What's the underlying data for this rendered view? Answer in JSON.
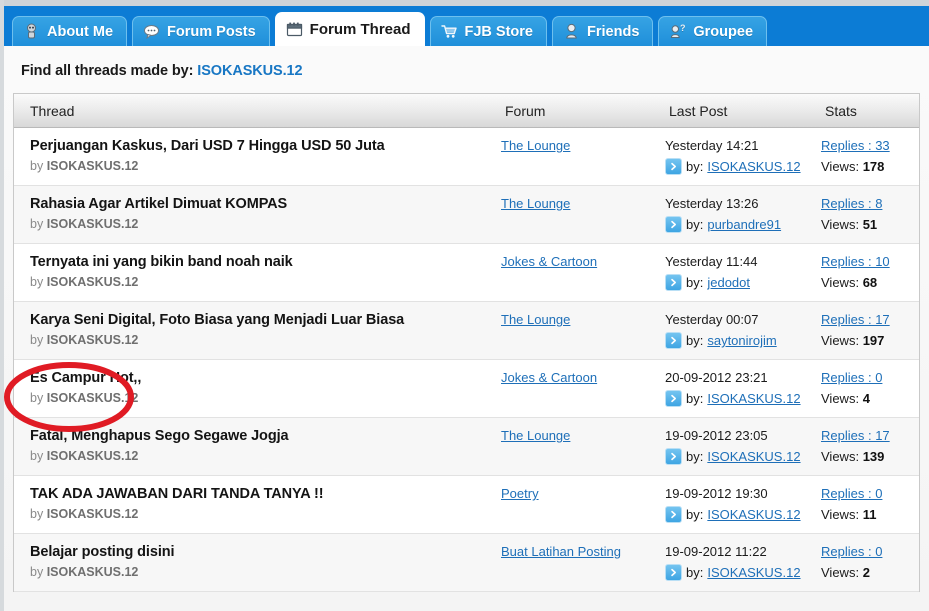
{
  "tabs": [
    {
      "label": "About Me",
      "icon": "user-avatar-icon",
      "active": false
    },
    {
      "label": "Forum Posts",
      "icon": "speech-bubble-icon",
      "active": false
    },
    {
      "label": "Forum Thread",
      "icon": "calendar-icon",
      "active": true
    },
    {
      "label": "FJB Store",
      "icon": "shopping-cart-icon",
      "active": false
    },
    {
      "label": "Friends",
      "icon": "user-bust-icon",
      "active": false
    },
    {
      "label": "Groupee",
      "icon": "user-question-icon",
      "active": false
    }
  ],
  "find_bar": {
    "prefix": "Find all threads made by:",
    "username": "ISOKASKUS.12"
  },
  "table": {
    "headers": {
      "thread": "Thread",
      "forum": "Forum",
      "last_post": "Last Post",
      "stats": "Stats"
    },
    "by_prefix": "by ",
    "lastpost_by_prefix": "by:",
    "views_label": "Views:",
    "rows": [
      {
        "title": "Perjuangan Kaskus, Dari USD 7 Hingga USD 50 Juta",
        "author": "ISOKASKUS.12",
        "forum": "The Lounge",
        "last_post_date": "Yesterday 14:21",
        "last_post_user": "ISOKASKUS.12",
        "replies": "Replies : 33",
        "views": "178",
        "highlighted": false
      },
      {
        "title": "Rahasia Agar Artikel Dimuat KOMPAS",
        "author": "ISOKASKUS.12",
        "forum": "The Lounge",
        "last_post_date": "Yesterday 13:26",
        "last_post_user": "purbandre91",
        "replies": "Replies : 8",
        "views": "51",
        "highlighted": false
      },
      {
        "title": "Ternyata ini yang bikin band noah naik",
        "author": "ISOKASKUS.12",
        "forum": "Jokes & Cartoon",
        "last_post_date": "Yesterday 11:44",
        "last_post_user": "jedodot",
        "replies": "Replies : 10",
        "views": "68",
        "highlighted": false
      },
      {
        "title": "Karya Seni Digital, Foto Biasa yang Menjadi Luar Biasa",
        "author": "ISOKASKUS.12",
        "forum": "The Lounge",
        "last_post_date": "Yesterday 00:07",
        "last_post_user": "saytonirojim",
        "replies": "Replies : 17",
        "views": "197",
        "highlighted": false
      },
      {
        "title": "Es Campur Hot,,",
        "author": "ISOKASKUS.12",
        "forum": "Jokes & Cartoon",
        "last_post_date": "20-09-2012 23:21",
        "last_post_user": "ISOKASKUS.12",
        "replies": "Replies : 0",
        "views": "4",
        "highlighted": true
      },
      {
        "title": "Fatal, Menghapus Sego Segawe Jogja",
        "author": "ISOKASKUS.12",
        "forum": "The Lounge",
        "last_post_date": "19-09-2012 23:05",
        "last_post_user": "ISOKASKUS.12",
        "replies": "Replies : 17",
        "views": "139",
        "highlighted": false
      },
      {
        "title": "TAK ADA JAWABAN DARI TANDA TANYA !!",
        "author": "ISOKASKUS.12",
        "forum": "Poetry",
        "last_post_date": "19-09-2012 19:30",
        "last_post_user": "ISOKASKUS.12",
        "replies": "Replies : 0",
        "views": "11",
        "highlighted": false
      },
      {
        "title": "Belajar posting disini",
        "author": "ISOKASKUS.12",
        "forum": "Buat Latihan Posting",
        "last_post_date": "19-09-2012 11:22",
        "last_post_user": "ISOKASKUS.12",
        "replies": "Replies : 0",
        "views": "2",
        "highlighted": false
      }
    ]
  },
  "annotation": {
    "shape": "red-ellipse",
    "color": "#e01b24",
    "targets_row_index": 4
  },
  "colors": {
    "tabbar_blue": "#0c7cd5",
    "tab_blue": "#2b9ae0",
    "link_blue": "#1e6fb8",
    "username_blue": "#1877c4",
    "annotation_red": "#e01b24"
  }
}
